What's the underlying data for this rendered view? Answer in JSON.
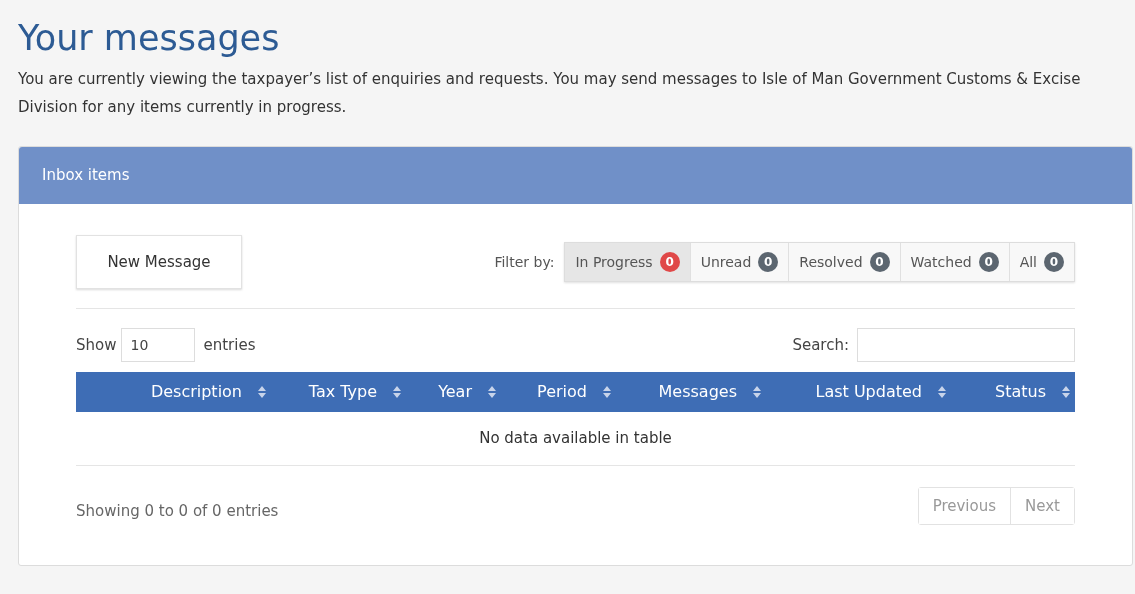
{
  "page": {
    "title": "Your messages",
    "intro": "You are currently viewing the taxpayer’s list of enquiries and requests. You may send messages to Isle of Man Government Customs & Excise Division for any items currently in progress."
  },
  "panel": {
    "title": "Inbox items",
    "new_message_button": "New Message",
    "filter_label": "Filter by:",
    "filters": [
      {
        "label": "In Progress",
        "count": "0",
        "selected": true
      },
      {
        "label": "Unread",
        "count": "0",
        "selected": false
      },
      {
        "label": "Resolved",
        "count": "0",
        "selected": false
      },
      {
        "label": "Watched",
        "count": "0",
        "selected": false
      },
      {
        "label": "All",
        "count": "0",
        "selected": false
      }
    ],
    "show_label": "Show",
    "page_size": "10",
    "entries_label": "entries",
    "search_label": "Search:",
    "table": {
      "columns": [
        "Description",
        "Tax Type",
        "Year",
        "Period",
        "Messages",
        "Last Updated",
        "Status"
      ],
      "empty_text": "No data available in table"
    },
    "info": "Showing 0 to 0 of 0 entries",
    "pagination": [
      "Previous",
      "Next"
    ]
  }
}
